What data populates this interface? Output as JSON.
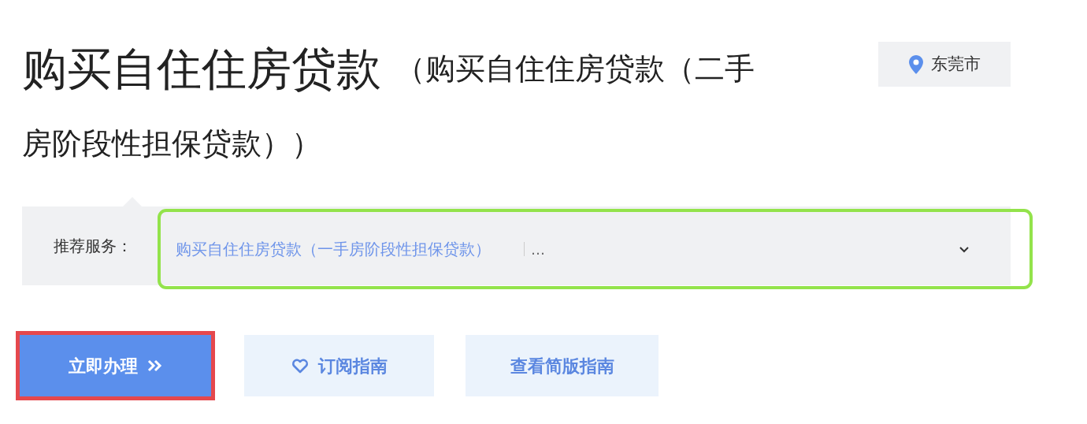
{
  "heading": {
    "title": "购买自住住房贷款",
    "subtitle_lines": [
      "（购买自住住房贷款（二手",
      "房阶段性担保贷款））"
    ]
  },
  "location": {
    "label": "东莞市"
  },
  "recommend": {
    "label": "推荐服务：",
    "highlighted": true,
    "service": "购买自住住房贷款（一手房阶段性担保贷款）",
    "more": "…"
  },
  "buttons": [
    {
      "kind": "primary",
      "label": "立即办理",
      "highlighted": true
    },
    {
      "kind": "subscribe",
      "label": "订阅指南",
      "highlighted": false
    },
    {
      "kind": "plain",
      "label": "查看简版指南",
      "highlighted": false
    }
  ]
}
